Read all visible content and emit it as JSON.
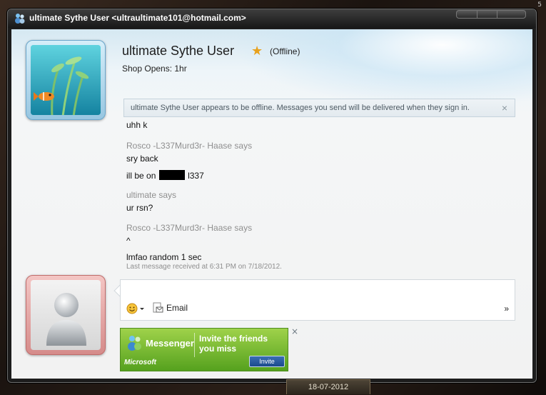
{
  "window": {
    "title": "ultimate Sythe User <ultraultimate101@hotmail.com>"
  },
  "frame": {
    "corner_label": "5",
    "date": "18-07-2012"
  },
  "contact": {
    "name": "ultimate Sythe User",
    "status": "(Offline)",
    "personal_message": "Shop Opens: 1hr",
    "favorite_icon": "star-icon"
  },
  "offline_banner": {
    "text": "ultimate Sythe User appears to be offline. Messages you send will be delivered when they sign in.",
    "close": "×"
  },
  "conversation": {
    "lines": [
      {
        "kind": "msg",
        "text": "uhh k"
      },
      {
        "kind": "says",
        "text": "Rosco -L337Murd3r- Haase says"
      },
      {
        "kind": "msg",
        "text": "sry back"
      },
      {
        "kind": "msg_redacted",
        "before": "ill be on",
        "after": "l337"
      },
      {
        "kind": "says",
        "text": "ultimate says"
      },
      {
        "kind": "msg",
        "text": "ur rsn?"
      },
      {
        "kind": "says",
        "text": "Rosco -L337Murd3r- Haase says"
      },
      {
        "kind": "msg",
        "text": "^"
      },
      {
        "kind": "msg",
        "text": "lmfao random 1 sec"
      }
    ],
    "last_received": "Last message received at 6:31 PM on 7/18/2012."
  },
  "toolbar": {
    "email_label": "Email",
    "more_label": "»"
  },
  "ad": {
    "brand": "Messenger",
    "text": "Invite the friends you miss",
    "microsoft": "Microsoft",
    "button": "Invite",
    "close": "×"
  }
}
